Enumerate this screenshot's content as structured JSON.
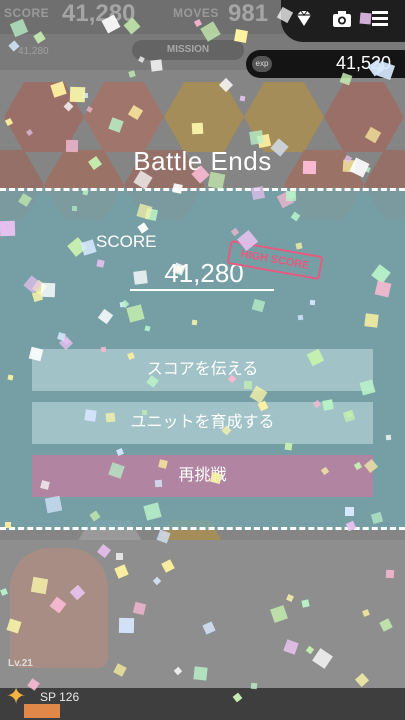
{
  "hud": {
    "score_label": "SCORE",
    "score_value": "41,280",
    "moves_label": "MOVES",
    "moves_value": "981",
    "mission_label": "MISSION",
    "previous_score": "41,280"
  },
  "topmenu": {
    "gem_icon": "diamond-icon",
    "camera_icon": "camera-icon",
    "menu_icon": "hamburger-menu-icon"
  },
  "exp": {
    "tag": "exp",
    "value": "41,520"
  },
  "result": {
    "title": "Battle Ends",
    "score_label": "SCORE",
    "score_value": "41,280",
    "high_score_badge": "HIGH SCORE"
  },
  "buttons": {
    "share": "スコアを伝える",
    "train": "ユニットを育成する",
    "retry": "再挑戦"
  },
  "footer": {
    "sp_label": "SP 126",
    "level": "Lv.21"
  },
  "colors": {
    "panel": "#72a6ae",
    "retry_button": "#c87aa0",
    "high_score": "#e65a7e",
    "accent": "#f4b23e"
  }
}
